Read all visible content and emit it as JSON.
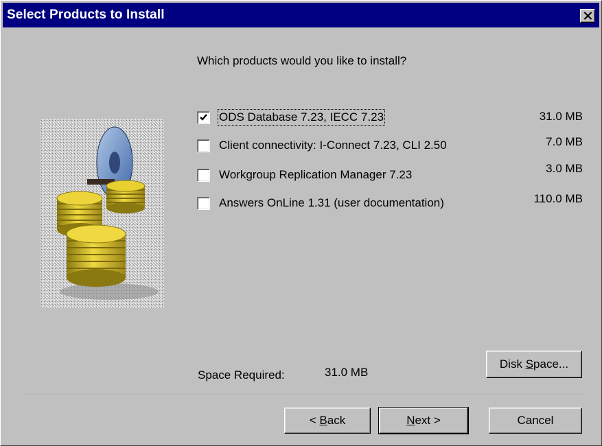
{
  "window": {
    "title": "Select Products to Install"
  },
  "prompt": "Which products would you like to install?",
  "products": [
    {
      "label": "ODS Database 7.23, IECC 7.23",
      "size": "31.0 MB",
      "checked": true
    },
    {
      "label": "Client connectivity: I-Connect 7.23, CLI 2.50",
      "size": "7.0 MB",
      "checked": false
    },
    {
      "label": "Workgroup Replication Manager 7.23",
      "size": "3.0 MB",
      "checked": false
    },
    {
      "label": "Answers OnLine 1.31 (user documentation)",
      "size": "110.0 MB",
      "checked": false
    }
  ],
  "space": {
    "label": "Space Required:",
    "value": "31.0 MB"
  },
  "buttons": {
    "disk_space": {
      "pre": "Disk ",
      "accel": "S",
      "post": "pace..."
    },
    "back": {
      "pre": "< ",
      "accel": "B",
      "post": "ack"
    },
    "next": {
      "pre": "",
      "accel": "N",
      "post": "ext >"
    },
    "cancel": "Cancel"
  },
  "icons": {
    "close": "close-icon",
    "check": "checkmark-icon",
    "illustration": "database-disks-icon"
  }
}
